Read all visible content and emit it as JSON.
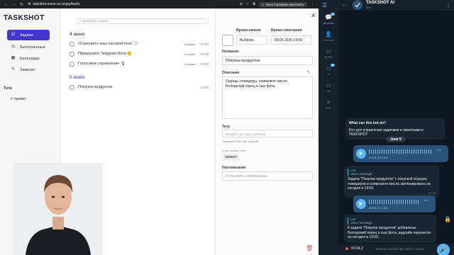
{
  "browser": {
    "url": "taskshot.mess-ai.ru/app/tasks",
    "incognito_label": "Окно в режиме инкогнито"
  },
  "app": {
    "logo": "TASKSHOT",
    "nav": [
      {
        "label": "Задачи",
        "icon": "checkbox-icon",
        "active": true
      },
      {
        "label": "Выполненные",
        "icon": "check-circle-icon",
        "active": false
      },
      {
        "label": "Календарь",
        "icon": "calendar-icon",
        "active": false
      },
      {
        "label": "Заметки",
        "icon": "note-icon",
        "active": false
      }
    ],
    "tags_heading": "Теги",
    "tags": [
      "# привет"
    ],
    "add_task_placeholder": "+ Добавить задачу",
    "days": [
      {
        "heading": "4 июня",
        "tasks": [
          {
            "title": "Установите ваш часовой пояс 🕐",
            "tag": "# привет",
            "time": "03:00"
          },
          {
            "title": "Прикрепите Telegram-бота 🙂",
            "tag": "# привет",
            "time": "03:00"
          },
          {
            "title": "Голосовое управление 🎙",
            "tag": "# привет",
            "time": "03:00"
          }
        ]
      },
      {
        "heading": "5 июня",
        "tasks": [
          {
            "title": "Покупка продуктов",
            "tag": "",
            "time": "19:00"
          }
        ]
      }
    ],
    "detail": {
      "start_label": "Время начала",
      "end_label": "Время окончания",
      "start_value": "Выбрать",
      "end_value": "05.06.2025 19:00",
      "name_label": "Название",
      "name_value": "Покупка продуктов",
      "desc_label": "Описание",
      "desc_value": "Огурцы, помидоры, оливковое масло\nБолгарский перец и сыр фета",
      "tags_label": "Теги",
      "tags_placeholder": "Введите тег через запятую",
      "tags_hint": "Нажмите Enter или запятой",
      "available_tags_label": "# Доступные теги",
      "available_tag": "привет",
      "reminder_label": "Напоминание",
      "reminder_placeholder": "Установить напоминание"
    }
  },
  "telegram": {
    "chat_title": "TASKSHOT AI",
    "chat_subtitle": "bot",
    "folders": [
      {
        "label": "All chats",
        "icon": "chats-icon",
        "active": true,
        "badge": "3"
      },
      {
        "label": "Personal",
        "icon": "person-icon",
        "active": false,
        "badge": ""
      },
      {
        "label": "WORK",
        "icon": "folder-icon",
        "active": false,
        "badge": ""
      },
      {
        "label": "AI",
        "icon": "folder-icon",
        "active": false,
        "badge": "2"
      },
      {
        "label": "HM",
        "icon": "folder-icon",
        "active": false,
        "badge": ""
      },
      {
        "label": "Edit",
        "icon": "sliders-icon",
        "active": false,
        "badge": ""
      }
    ],
    "intro_title": "What can this bot do?",
    "intro_text": "Бот для управления задачами и заметками в TASKSHOT",
    "date": "June 5",
    "voice1": {
      "duration": "00:05, 30.3 KB",
      "time": "4:4"
    },
    "reply1": {
      "from": "Leo",
      "quote": "Voice message",
      "text": "Задача \"Покупка продуктов\" с покупкой огурцов, помидоров и оливкового масла запланирована на сегодня в 19:00.",
      "time": "12:35"
    },
    "voice2": {
      "duration": "00:05, 21.1 KB",
      "time": "4:4"
    },
    "reply2": {
      "from": "Leo",
      "quote": "Voice message",
      "text": "К задаче \"Покупка продуктов\" добавлены болгарский перец и сыр фета, дедлайн перенесён на сегодня в 19:00.",
      "time": "12:35"
    },
    "recording_time": "00:04,2",
    "recording_hint": "Release outside this field to cancel"
  }
}
